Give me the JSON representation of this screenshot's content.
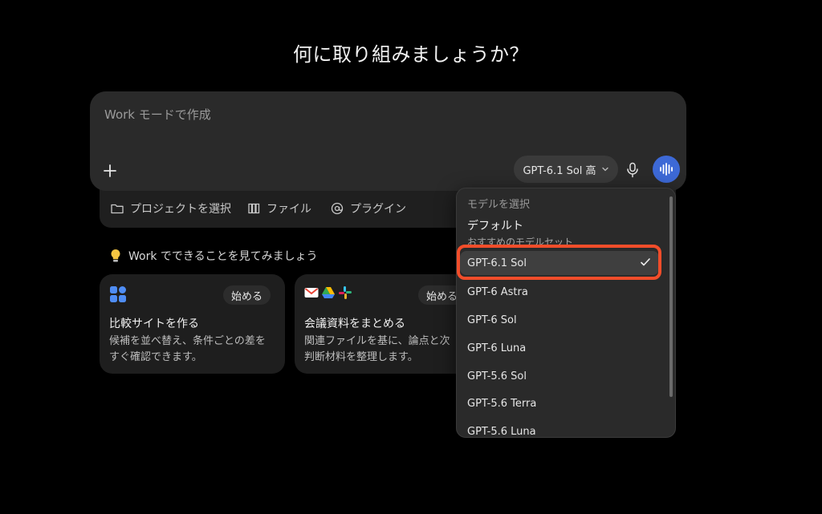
{
  "headline": "何に取り組みましょうか？",
  "composer": {
    "placeholder": "Work モードで作成",
    "model_button_label": "GPT-6.1 Sol 高"
  },
  "context_bar": {
    "items": [
      {
        "label": "プロジェクトを選択",
        "icon": "folder-icon"
      },
      {
        "label": "ファイル",
        "icon": "files-icon"
      },
      {
        "label": "プラグイン",
        "icon": "at-icon"
      }
    ]
  },
  "suggestions": {
    "heading": "Work でできることを見てみましょう",
    "cards": [
      {
        "title": "比較サイトを作る",
        "description": "候補を並べ替え、条件ごとの差を\nすぐ確認できます。",
        "button": "始める"
      },
      {
        "title": "会議資料をまとめる",
        "description": "関連ファイルを基に、論点と次\n判断材料を整理します。",
        "button": "始める"
      }
    ]
  },
  "model_menu": {
    "label": "モデルを選択",
    "default": {
      "title": "デフォルト",
      "subtitle": "おすすめのモデルセット"
    },
    "items": [
      {
        "label": "GPT-6.1 Sol",
        "selected": true
      },
      {
        "label": "GPT-6 Astra",
        "selected": false
      },
      {
        "label": "GPT-6 Sol",
        "selected": false
      },
      {
        "label": "GPT-6 Luna",
        "selected": false
      },
      {
        "label": "GPT-5.6 Sol",
        "selected": false
      },
      {
        "label": "GPT-5.6 Terra",
        "selected": false
      },
      {
        "label": "GPT-5.6 Luna",
        "selected": false
      }
    ]
  },
  "colors": {
    "background": "#000000",
    "panel": "#2a2a2a",
    "accent_blue": "#3d69d6",
    "highlight_red": "#f24d2a"
  }
}
